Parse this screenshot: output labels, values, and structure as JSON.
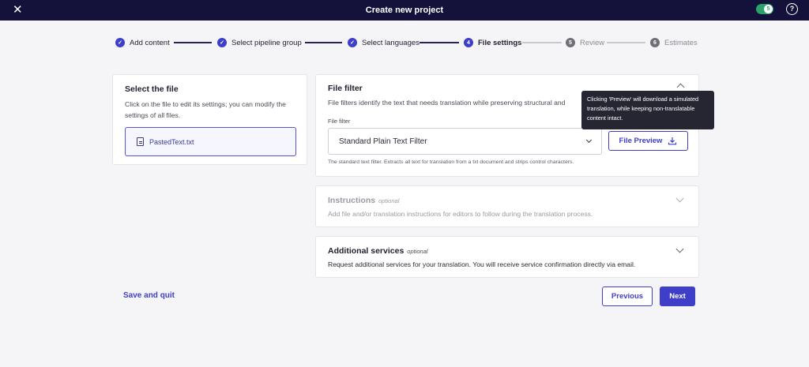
{
  "header": {
    "title": "Create new project",
    "close_icon": "close-icon",
    "toggle_badge": "5",
    "help_symbol": "?"
  },
  "stepper": {
    "steps": [
      {
        "label": "Add content",
        "state": "done",
        "marker": "✓"
      },
      {
        "label": "Select pipeline group",
        "state": "done",
        "marker": "✓"
      },
      {
        "label": "Select languages",
        "state": "done",
        "marker": "✓"
      },
      {
        "label": "File settings",
        "state": "current",
        "marker": "4"
      },
      {
        "label": "Review",
        "state": "todo",
        "marker": "5"
      },
      {
        "label": "Estimates",
        "state": "todo",
        "marker": "6"
      }
    ]
  },
  "file_panel": {
    "title": "Select the file",
    "description": "Click on the file to edit its settings; you can modify the settings of all files.",
    "files": [
      {
        "name": "PastedText.txt"
      }
    ]
  },
  "file_filter": {
    "title": "File filter",
    "description": "File filters identify the text that needs translation while preserving structural and",
    "field_label": "File filter",
    "selected_value": "Standard Plain Text Filter",
    "preview_label": "File Preview",
    "help_text": "The standard text filter. Extracts all text for translation from a txt document and strips control characters."
  },
  "tooltip": {
    "text": "Clicking 'Preview' will download a simulated translation, while keeping non-translatable content intact."
  },
  "instructions": {
    "title": "Instructions",
    "optional": "optional",
    "description": "Add file and/or translation instructions for editors to follow during the translation process."
  },
  "additional_services": {
    "title": "Additional services",
    "optional": "optional",
    "description": "Request additional services for your translation. You will receive service confirmation directly via email."
  },
  "footer": {
    "save_quit": "Save and quit",
    "previous": "Previous",
    "next": "Next"
  },
  "colors": {
    "header_bg": "#14123a",
    "accent": "#3e3ec8",
    "toggle_on": "#2aa36b"
  }
}
